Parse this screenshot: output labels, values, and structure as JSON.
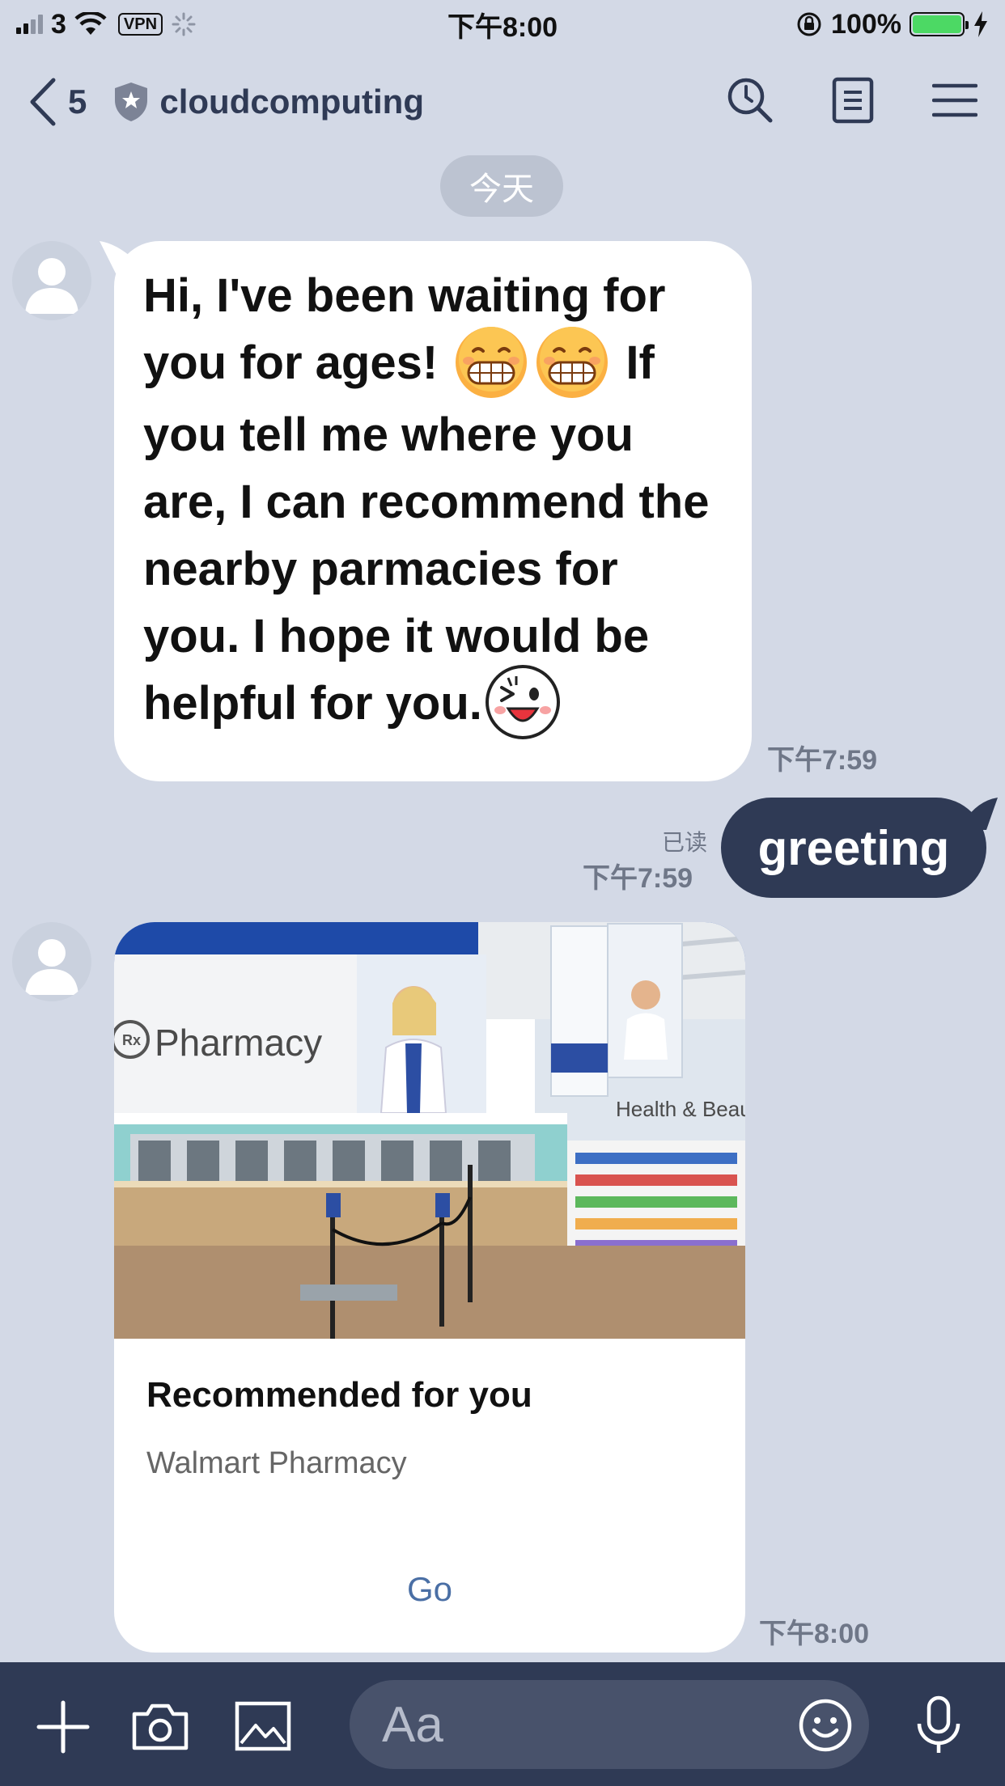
{
  "status_bar": {
    "carrier": "3",
    "vpn_label": "VPN",
    "time": "下午8:00",
    "battery_percent": "100%",
    "battery_level": 1.0,
    "signal_bars_filled": 2,
    "signal_bars_total": 4
  },
  "header": {
    "back_count": "5",
    "title": "cloudcomputing",
    "icons": [
      "chevron-left-icon",
      "shield-star-icon",
      "search-icon",
      "notes-icon",
      "menu-icon"
    ]
  },
  "date_divider": "今天",
  "messages": [
    {
      "direction": "incoming",
      "parts": [
        "Hi, I've been waiting for you for ages!",
        "grinning-face-emoji",
        "grinning-face-emoji",
        "If you tell me where you are, I can recommend the nearby parmacies for you. I hope it would be helpful for you.",
        "winking-face-emoji"
      ],
      "text_1": "Hi, I've been waiting for you for ages!",
      "text_2": "If you tell me where you are, I can recommend the nearby parmacies for you. I hope it would be helpful for you.",
      "time": "下午7:59"
    },
    {
      "direction": "outgoing",
      "text": "greeting",
      "read_label": "已读",
      "time": "下午7:59"
    },
    {
      "direction": "incoming",
      "type": "card",
      "image_sign_text": "Pharmacy",
      "image_sign_text_2": "Health & Beauty",
      "card_title": "Recommended for you",
      "card_subtitle": "Walmart Pharmacy",
      "action_label": "Go",
      "time": "下午8:00"
    }
  ],
  "input_bar": {
    "placeholder": "Aa",
    "icons": [
      "plus-icon",
      "camera-icon",
      "image-icon",
      "emoji-icon",
      "microphone-icon"
    ]
  },
  "colors": {
    "background": "#d3d9e6",
    "header_text": "#2f3a55",
    "outgoing_bubble": "#2f3a55",
    "link": "#4a6fa5",
    "battery": "#4cd964"
  }
}
